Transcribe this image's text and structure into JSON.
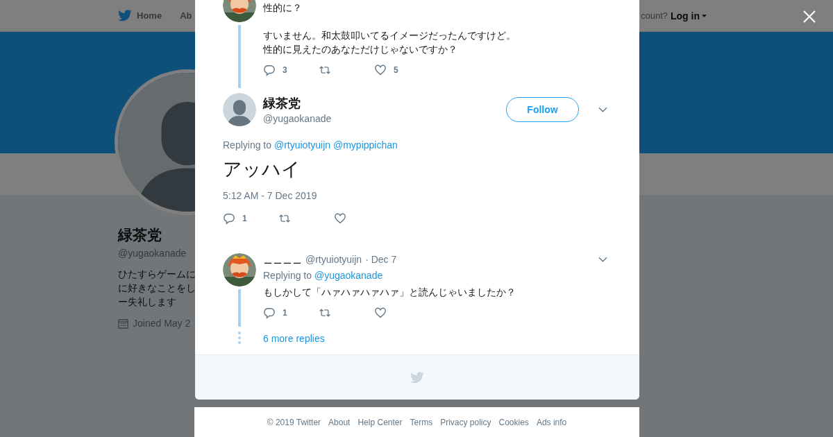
{
  "background_page": {
    "nav": {
      "items": [
        {
          "label": "Home"
        },
        {
          "label": "Ab"
        }
      ],
      "account_prompt": "count?",
      "login": "Log in"
    },
    "profile": {
      "name": "緑茶党",
      "handle": "@yugaokanade",
      "bio_lines": [
        "ひたすらゲームに",
        "に好きなことをし",
        "ー失礼します"
      ],
      "joined": "Joined May 2"
    }
  },
  "modal": {
    "tweets": [
      {
        "kind": "parent",
        "paragraphs": [
          [
            "性的に？"
          ],
          [
            "すいません。和太鼓叩いてるイメージだったんですけど。",
            "性的に見えたのあなただけじゃないですか？"
          ]
        ],
        "reply_count": "3",
        "like_count": "5"
      },
      {
        "kind": "focus",
        "name": "緑茶党",
        "handle": "@yugaokanade",
        "follow": "Follow",
        "replying_prefix": "Replying to",
        "mentions": [
          "@rtyuiotyuijn",
          "@mypippichan"
        ],
        "text": "アッハイ",
        "timestamp": "5:12 AM - 7 Dec 2019",
        "reply_count": "1"
      },
      {
        "kind": "reply",
        "name": "＿＿＿＿",
        "handle": "@rtyuiotyuijn",
        "date": "· Dec 7",
        "replying_prefix": "Replying to",
        "mentions": [
          "@yugaokanade"
        ],
        "text": "もしかして「ハァハァハァハァ」と読んじゃいましたか？",
        "reply_count": "1",
        "more_replies": "6 more replies"
      }
    ]
  },
  "footer": {
    "links": [
      "© 2019 Twitter",
      "About",
      "Help Center",
      "Terms",
      "Privacy policy",
      "Cookies",
      "Ads info"
    ]
  }
}
